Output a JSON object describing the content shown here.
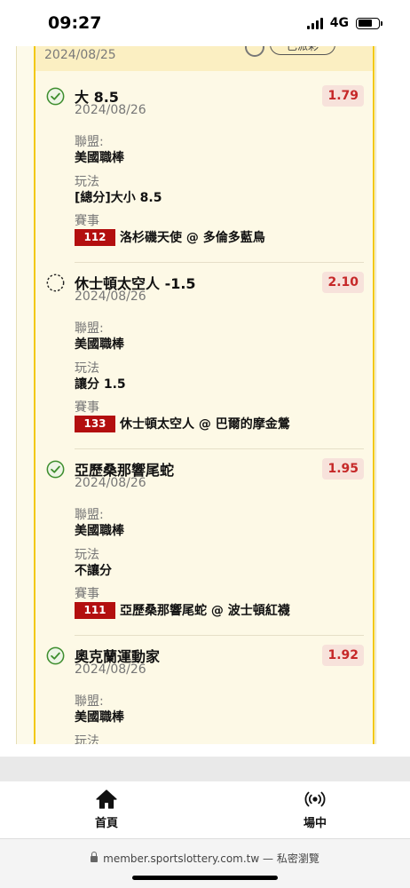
{
  "status_bar": {
    "time": "09:27",
    "network": "4G",
    "battery_level": 0.72
  },
  "panel_header": {
    "date": "2024/08/25",
    "button_label": "已派彩"
  },
  "labels": {
    "league": "聯盟:",
    "play": "玩法",
    "match": "賽事"
  },
  "bets": [
    {
      "status": "won",
      "title": "大 8.5",
      "date": "2024/08/26",
      "odds": "1.79",
      "league": "美國職棒",
      "play": "[總分]大小 8.5",
      "match_code": "112",
      "match": "洛杉磯天使 @ 多倫多藍鳥"
    },
    {
      "status": "pending",
      "title": "休士頓太空人 -1.5",
      "date": "2024/08/26",
      "odds": "2.10",
      "league": "美國職棒",
      "play": "讓分 1.5",
      "match_code": "133",
      "match": "休士頓太空人 @ 巴爾的摩金鶯"
    },
    {
      "status": "won",
      "title": "亞歷桑那響尾蛇",
      "date": "2024/08/26",
      "odds": "1.95",
      "league": "美國職棒",
      "play": "不讓分",
      "match_code": "111",
      "match": "亞歷桑那響尾蛇 @ 波士頓紅襪"
    },
    {
      "status": "won",
      "title": "奧克蘭運動家",
      "date": "2024/08/26",
      "odds": "1.92",
      "league": "美國職棒"
    }
  ],
  "bottom_nav": [
    {
      "label": "首頁",
      "icon": "home-icon"
    },
    {
      "label": "場中",
      "icon": "live-broadcast-icon"
    }
  ],
  "browser": {
    "url": "member.sportslottery.com.tw",
    "mode": "— 私密瀏覽"
  },
  "colors": {
    "accent_yellow": "#f2c811",
    "odds_red": "#c62828",
    "match_badge": "#b30f0f",
    "won_green": "#3e8e2e"
  }
}
